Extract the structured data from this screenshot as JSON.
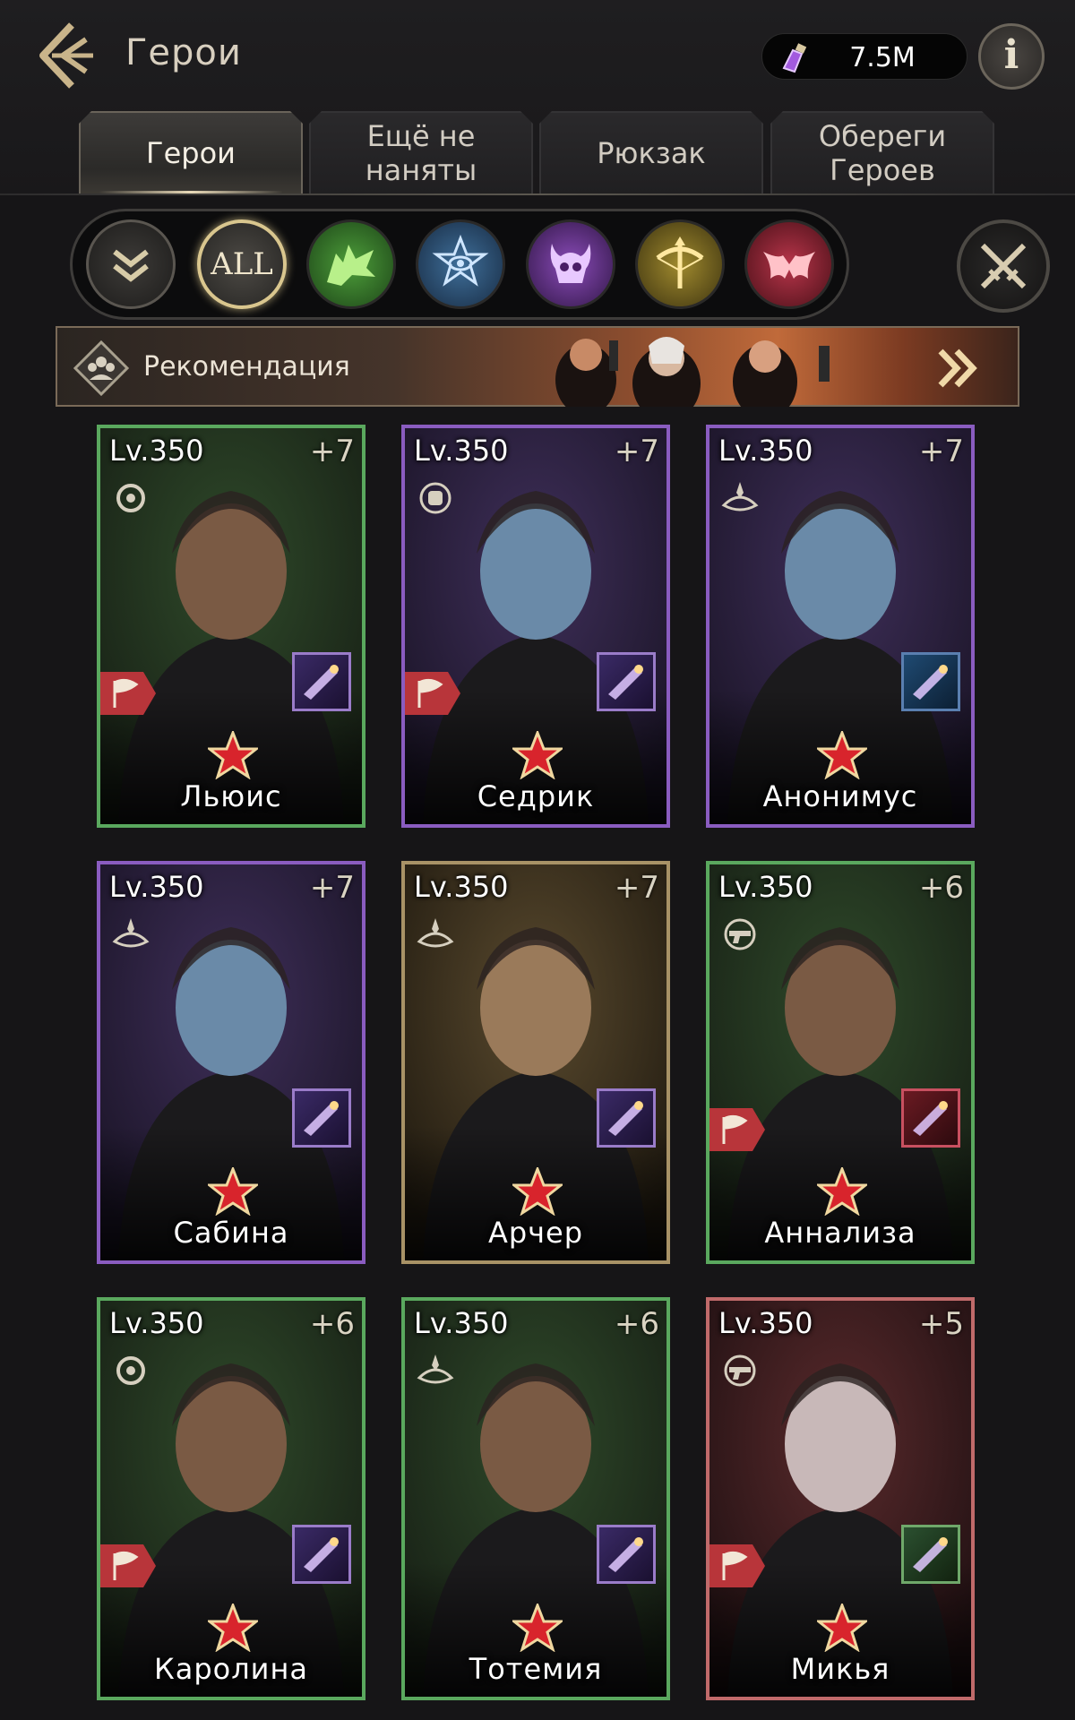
{
  "header": {
    "title": "Герои",
    "currency_amount": "7.5M",
    "info_label": "i"
  },
  "tabs": [
    {
      "label": "Герои",
      "active": true
    },
    {
      "label": "Ещё не наняты",
      "active": false
    },
    {
      "label": "Рюкзак",
      "active": false
    },
    {
      "label": "Обереги Героев",
      "active": false
    }
  ],
  "filters": {
    "all_label": "ALL",
    "items": [
      "collapse",
      "all",
      "wolf",
      "eye",
      "demon",
      "crossbow",
      "bat"
    ],
    "selected": "all"
  },
  "recommendation": {
    "label": "Рекомендация"
  },
  "heroes": [
    {
      "level": "Lv.350",
      "plus": "+7",
      "name": "Льюис",
      "rarity": "green",
      "class_icon": "gear-class-icon",
      "weapon_icon": "golden-pistol-icon",
      "has_flag": true
    },
    {
      "level": "Lv.350",
      "plus": "+7",
      "name": "Седрик",
      "rarity": "purple",
      "class_icon": "fist-class-icon",
      "weapon_icon": "scythe-icon",
      "has_flag": true
    },
    {
      "level": "Lv.350",
      "plus": "+7",
      "name": "Анонимус",
      "rarity": "purple",
      "class_icon": "lotus-class-icon",
      "weapon_icon": "sickle-icon",
      "has_flag": false
    },
    {
      "level": "Lv.350",
      "plus": "+7",
      "name": "Сабина",
      "rarity": "purple",
      "class_icon": "lotus-class-icon",
      "weapon_icon": "wings-icon",
      "has_flag": false
    },
    {
      "level": "Lv.350",
      "plus": "+7",
      "name": "Арчер",
      "rarity": "gold",
      "class_icon": "lotus-class-icon",
      "weapon_icon": "bow-icon",
      "has_flag": false
    },
    {
      "level": "Lv.350",
      "plus": "+6",
      "name": "Аннализа",
      "rarity": "green",
      "class_icon": "pistol-class-icon",
      "weapon_icon": "pink-pistol-icon",
      "has_flag": true
    },
    {
      "level": "Lv.350",
      "plus": "+6",
      "name": "Каролина",
      "rarity": "green",
      "class_icon": "gear-class-icon",
      "weapon_icon": "claws-icon",
      "has_flag": true
    },
    {
      "level": "Lv.350",
      "plus": "+6",
      "name": "Тотемия",
      "rarity": "green",
      "class_icon": "lotus-class-icon",
      "weapon_icon": "green-crystal-icon",
      "has_flag": false
    },
    {
      "level": "Lv.350",
      "plus": "+5",
      "name": "Микья",
      "rarity": "red",
      "class_icon": "pistol-class-icon",
      "weapon_icon": "dagger-icon",
      "has_flag": true
    }
  ],
  "colors": {
    "background": "#161517",
    "rarity_green": "#5aa85e",
    "rarity_purple": "#8a5cc0",
    "rarity_gold": "#a89266",
    "rarity_red": "#c06a6a",
    "accent_gold": "#d9c68e"
  }
}
